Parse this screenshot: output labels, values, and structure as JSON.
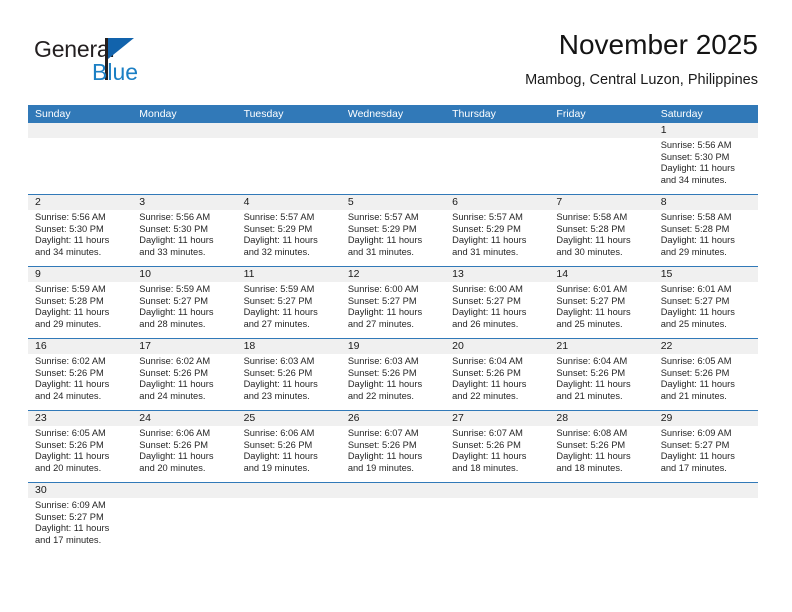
{
  "brand": {
    "name_dark": "General",
    "name_blue": "Blue",
    "accent_color": "#1b7fc4",
    "triangle_color": "#1263ac"
  },
  "header": {
    "title": "November 2025",
    "subtitle": "Mambog, Central Luzon, Philippines"
  },
  "theme": {
    "header_blue": "#3179b8",
    "band_gray": "#f0f0f0",
    "text_dark": "#262626"
  },
  "weekday_headers": [
    "Sunday",
    "Monday",
    "Tuesday",
    "Wednesday",
    "Thursday",
    "Friday",
    "Saturday"
  ],
  "weeks": [
    [
      {
        "day": "",
        "lines": []
      },
      {
        "day": "",
        "lines": []
      },
      {
        "day": "",
        "lines": []
      },
      {
        "day": "",
        "lines": []
      },
      {
        "day": "",
        "lines": []
      },
      {
        "day": "",
        "lines": []
      },
      {
        "day": "1",
        "lines": [
          "Sunrise: 5:56 AM",
          "Sunset: 5:30 PM",
          "Daylight: 11 hours",
          "and 34 minutes."
        ]
      }
    ],
    [
      {
        "day": "2",
        "lines": [
          "Sunrise: 5:56 AM",
          "Sunset: 5:30 PM",
          "Daylight: 11 hours",
          "and 34 minutes."
        ]
      },
      {
        "day": "3",
        "lines": [
          "Sunrise: 5:56 AM",
          "Sunset: 5:30 PM",
          "Daylight: 11 hours",
          "and 33 minutes."
        ]
      },
      {
        "day": "4",
        "lines": [
          "Sunrise: 5:57 AM",
          "Sunset: 5:29 PM",
          "Daylight: 11 hours",
          "and 32 minutes."
        ]
      },
      {
        "day": "5",
        "lines": [
          "Sunrise: 5:57 AM",
          "Sunset: 5:29 PM",
          "Daylight: 11 hours",
          "and 31 minutes."
        ]
      },
      {
        "day": "6",
        "lines": [
          "Sunrise: 5:57 AM",
          "Sunset: 5:29 PM",
          "Daylight: 11 hours",
          "and 31 minutes."
        ]
      },
      {
        "day": "7",
        "lines": [
          "Sunrise: 5:58 AM",
          "Sunset: 5:28 PM",
          "Daylight: 11 hours",
          "and 30 minutes."
        ]
      },
      {
        "day": "8",
        "lines": [
          "Sunrise: 5:58 AM",
          "Sunset: 5:28 PM",
          "Daylight: 11 hours",
          "and 29 minutes."
        ]
      }
    ],
    [
      {
        "day": "9",
        "lines": [
          "Sunrise: 5:59 AM",
          "Sunset: 5:28 PM",
          "Daylight: 11 hours",
          "and 29 minutes."
        ]
      },
      {
        "day": "10",
        "lines": [
          "Sunrise: 5:59 AM",
          "Sunset: 5:27 PM",
          "Daylight: 11 hours",
          "and 28 minutes."
        ]
      },
      {
        "day": "11",
        "lines": [
          "Sunrise: 5:59 AM",
          "Sunset: 5:27 PM",
          "Daylight: 11 hours",
          "and 27 minutes."
        ]
      },
      {
        "day": "12",
        "lines": [
          "Sunrise: 6:00 AM",
          "Sunset: 5:27 PM",
          "Daylight: 11 hours",
          "and 27 minutes."
        ]
      },
      {
        "day": "13",
        "lines": [
          "Sunrise: 6:00 AM",
          "Sunset: 5:27 PM",
          "Daylight: 11 hours",
          "and 26 minutes."
        ]
      },
      {
        "day": "14",
        "lines": [
          "Sunrise: 6:01 AM",
          "Sunset: 5:27 PM",
          "Daylight: 11 hours",
          "and 25 minutes."
        ]
      },
      {
        "day": "15",
        "lines": [
          "Sunrise: 6:01 AM",
          "Sunset: 5:27 PM",
          "Daylight: 11 hours",
          "and 25 minutes."
        ]
      }
    ],
    [
      {
        "day": "16",
        "lines": [
          "Sunrise: 6:02 AM",
          "Sunset: 5:26 PM",
          "Daylight: 11 hours",
          "and 24 minutes."
        ]
      },
      {
        "day": "17",
        "lines": [
          "Sunrise: 6:02 AM",
          "Sunset: 5:26 PM",
          "Daylight: 11 hours",
          "and 24 minutes."
        ]
      },
      {
        "day": "18",
        "lines": [
          "Sunrise: 6:03 AM",
          "Sunset: 5:26 PM",
          "Daylight: 11 hours",
          "and 23 minutes."
        ]
      },
      {
        "day": "19",
        "lines": [
          "Sunrise: 6:03 AM",
          "Sunset: 5:26 PM",
          "Daylight: 11 hours",
          "and 22 minutes."
        ]
      },
      {
        "day": "20",
        "lines": [
          "Sunrise: 6:04 AM",
          "Sunset: 5:26 PM",
          "Daylight: 11 hours",
          "and 22 minutes."
        ]
      },
      {
        "day": "21",
        "lines": [
          "Sunrise: 6:04 AM",
          "Sunset: 5:26 PM",
          "Daylight: 11 hours",
          "and 21 minutes."
        ]
      },
      {
        "day": "22",
        "lines": [
          "Sunrise: 6:05 AM",
          "Sunset: 5:26 PM",
          "Daylight: 11 hours",
          "and 21 minutes."
        ]
      }
    ],
    [
      {
        "day": "23",
        "lines": [
          "Sunrise: 6:05 AM",
          "Sunset: 5:26 PM",
          "Daylight: 11 hours",
          "and 20 minutes."
        ]
      },
      {
        "day": "24",
        "lines": [
          "Sunrise: 6:06 AM",
          "Sunset: 5:26 PM",
          "Daylight: 11 hours",
          "and 20 minutes."
        ]
      },
      {
        "day": "25",
        "lines": [
          "Sunrise: 6:06 AM",
          "Sunset: 5:26 PM",
          "Daylight: 11 hours",
          "and 19 minutes."
        ]
      },
      {
        "day": "26",
        "lines": [
          "Sunrise: 6:07 AM",
          "Sunset: 5:26 PM",
          "Daylight: 11 hours",
          "and 19 minutes."
        ]
      },
      {
        "day": "27",
        "lines": [
          "Sunrise: 6:07 AM",
          "Sunset: 5:26 PM",
          "Daylight: 11 hours",
          "and 18 minutes."
        ]
      },
      {
        "day": "28",
        "lines": [
          "Sunrise: 6:08 AM",
          "Sunset: 5:26 PM",
          "Daylight: 11 hours",
          "and 18 minutes."
        ]
      },
      {
        "day": "29",
        "lines": [
          "Sunrise: 6:09 AM",
          "Sunset: 5:27 PM",
          "Daylight: 11 hours",
          "and 17 minutes."
        ]
      }
    ],
    [
      {
        "day": "30",
        "lines": [
          "Sunrise: 6:09 AM",
          "Sunset: 5:27 PM",
          "Daylight: 11 hours",
          "and 17 minutes."
        ]
      },
      {
        "day": "",
        "lines": []
      },
      {
        "day": "",
        "lines": []
      },
      {
        "day": "",
        "lines": []
      },
      {
        "day": "",
        "lines": []
      },
      {
        "day": "",
        "lines": []
      },
      {
        "day": "",
        "lines": []
      }
    ]
  ]
}
